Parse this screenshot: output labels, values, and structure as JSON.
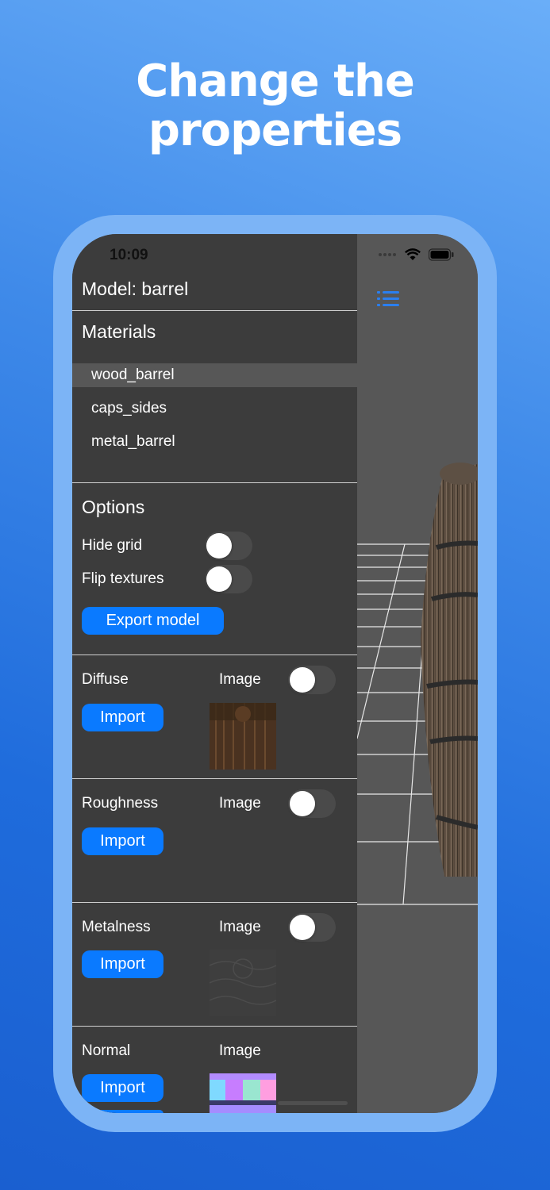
{
  "headline": {
    "line1": "Change the",
    "line2": "properties"
  },
  "status_bar": {
    "time": "10:09",
    "icons": [
      "signal-dots-icon",
      "wifi-icon",
      "battery-icon"
    ]
  },
  "model": {
    "title": "Model: barrel"
  },
  "materials": {
    "title": "Materials",
    "items": [
      {
        "label": "wood_barrel",
        "selected": true
      },
      {
        "label": "caps_sides",
        "selected": false
      },
      {
        "label": "metal_barrel",
        "selected": false
      }
    ]
  },
  "options": {
    "title": "Options",
    "hide_grid": {
      "label": "Hide grid",
      "on": false
    },
    "flip_textures": {
      "label": "Flip textures",
      "on": false
    },
    "export_label": "Export model"
  },
  "textures": [
    {
      "name": "Diffuse",
      "image_label": "Image",
      "toggle_on": false,
      "import_label": "Import",
      "thumbnail": "wood"
    },
    {
      "name": "Roughness",
      "image_label": "Image",
      "toggle_on": false,
      "import_label": "Import",
      "thumbnail": "none"
    },
    {
      "name": "Metalness",
      "image_label": "Image",
      "toggle_on": false,
      "import_label": "Import",
      "thumbnail": "gray"
    },
    {
      "name": "Normal",
      "image_label": "Image",
      "import_label": "Import",
      "thumbnail": "normal-map"
    }
  ],
  "colors": {
    "accent": "#0a7aff",
    "panel": "#3c3c3c",
    "viewport": "#575757"
  }
}
